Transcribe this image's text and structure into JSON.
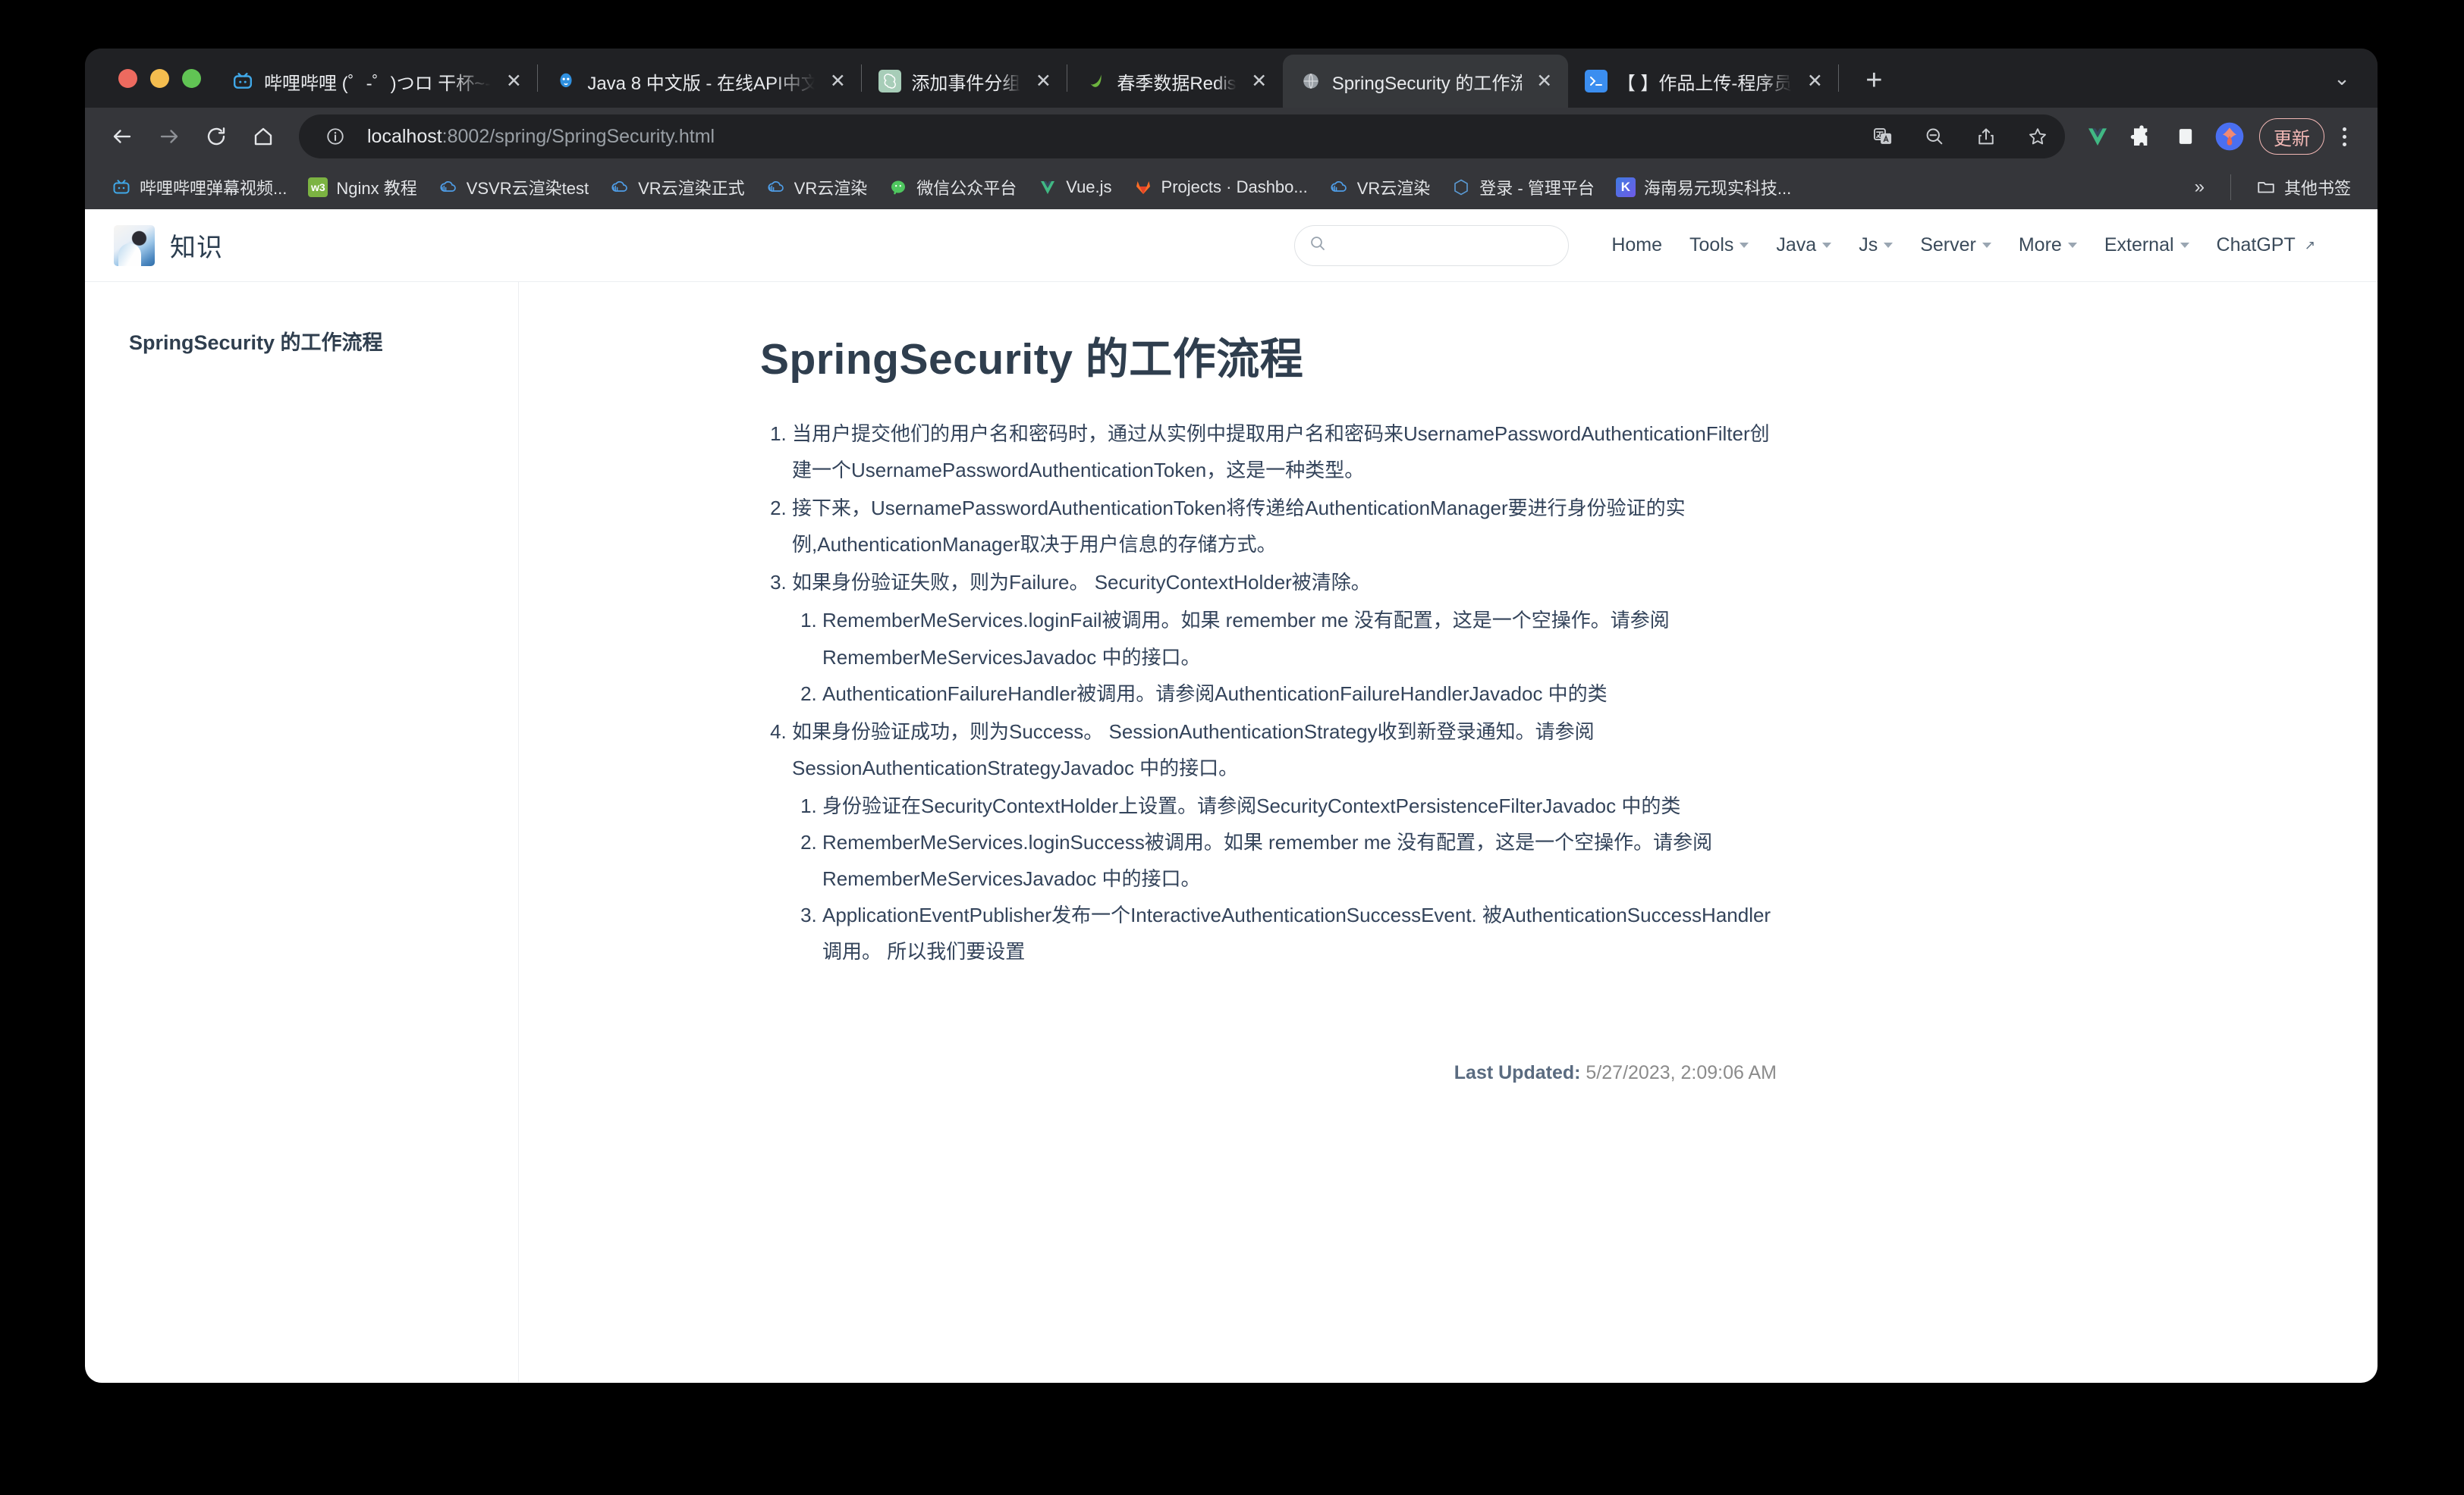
{
  "browser": {
    "tabs": [
      {
        "title": "哔哩哔哩 (゜-゜)つロ 干杯~-",
        "favicon": "bilibili-icon",
        "active": false
      },
      {
        "title": "Java 8 中文版 - 在线API中文",
        "favicon": "java-icon",
        "active": false
      },
      {
        "title": "添加事件分组",
        "favicon": "chatgpt-icon",
        "active": false
      },
      {
        "title": "春季数据Redis",
        "favicon": "spring-icon",
        "active": false
      },
      {
        "title": "SpringSecurity 的工作流程",
        "favicon": "globe-icon",
        "active": true
      },
      {
        "title": "【        】作品上传-程序员",
        "favicon": "terminal-icon",
        "active": false
      }
    ],
    "close_label": "✕",
    "new_tab_label": "+",
    "tabstrip_overflow_label": "⌄",
    "toolbar": {
      "back_label": "back-arrow",
      "forward_label": "forward-arrow",
      "reload_label": "reload",
      "home_label": "home",
      "url_host": "localhost",
      "url_path": ":8002/spring/SpringSecurity.html",
      "site_info_label": "ⓘ",
      "icons": [
        "translate-icon",
        "zoom-out-icon",
        "share-icon",
        "bookmark-star-icon"
      ],
      "extensions": [
        "vue-extension-icon",
        "puzzle-extension-icon",
        "side-panel-icon",
        "profile-avatar-icon"
      ],
      "update_label": "更新"
    },
    "bookmarks": [
      {
        "label": "哔哩哔哩弹幕视频...",
        "icon": "bilibili-icon"
      },
      {
        "label": "Nginx 教程",
        "icon": "w3c-icon"
      },
      {
        "label": "VSVR云渲染test",
        "icon": "cloud-icon"
      },
      {
        "label": "VR云渲染正式",
        "icon": "cloud-icon"
      },
      {
        "label": "VR云渲染",
        "icon": "cloud-icon"
      },
      {
        "label": "微信公众平台",
        "icon": "wechat-icon"
      },
      {
        "label": "Vue.js",
        "icon": "vue-icon"
      },
      {
        "label": "Projects · Dashbo...",
        "icon": "gitlab-icon"
      },
      {
        "label": "VR云渲染",
        "icon": "cloud-icon"
      },
      {
        "label": "登录 - 管理平台",
        "icon": "hexagon-icon"
      },
      {
        "label": "海南易元现实科技...",
        "icon": "k-icon"
      }
    ],
    "bookmarks_overflow_label": "»",
    "other_bookmarks_label": "其他书签",
    "other_bookmarks_icon": "folder-icon"
  },
  "site": {
    "brand_title": "知识",
    "search_placeholder": "",
    "search_value": "",
    "search_icon": "search-icon",
    "nav": [
      {
        "label": "Home",
        "has_caret": false,
        "external": false
      },
      {
        "label": "Tools",
        "has_caret": true,
        "external": false
      },
      {
        "label": "Java",
        "has_caret": true,
        "external": false
      },
      {
        "label": "Js",
        "has_caret": true,
        "external": false
      },
      {
        "label": "Server",
        "has_caret": true,
        "external": false
      },
      {
        "label": "More",
        "has_caret": true,
        "external": false
      },
      {
        "label": "External",
        "has_caret": true,
        "external": false
      },
      {
        "label": "ChatGPT",
        "has_caret": false,
        "external": true
      }
    ],
    "external_link_glyph": "↗"
  },
  "sidebar": {
    "heading": "SpringSecurity 的工作流程"
  },
  "document": {
    "title": "SpringSecurity 的工作流程",
    "steps": [
      {
        "text": "当用户提交他们的用户名和密码时，通过从实例中提取用户名和密码来UsernamePasswordAuthenticationFilter创建一个UsernamePasswordAuthenticationToken，这是一种类型。",
        "children": []
      },
      {
        "text": "接下来，UsernamePasswordAuthenticationToken将传递给AuthenticationManager要进行身份验证的实例,AuthenticationManager取决于用户信息的存储方式。",
        "children": []
      },
      {
        "text": "如果身份验证失败，则为Failure。 SecurityContextHolder被清除。",
        "children": [
          "RememberMeServices.loginFail被调用。如果 remember me 没有配置，这是一个空操作。请参阅RememberMeServicesJavadoc 中的接口。",
          "AuthenticationFailureHandler被调用。请参阅AuthenticationFailureHandlerJavadoc 中的类"
        ]
      },
      {
        "text": "如果身份验证成功，则为Success。 SessionAuthenticationStrategy收到新登录通知。请参阅SessionAuthenticationStrategyJavadoc 中的接口。",
        "children": [
          "身份验证在SecurityContextHolder上设置。请参阅SecurityContextPersistenceFilterJavadoc 中的类",
          "RememberMeServices.loginSuccess被调用。如果 remember me 没有配置，这是一个空操作。请参阅RememberMeServicesJavadoc 中的接口。",
          "ApplicationEventPublisher发布一个InteractiveAuthenticationSuccessEvent. 被AuthenticationSuccessHandler调用。 所以我们要设置"
        ]
      }
    ],
    "last_updated_label": "Last Updated:",
    "last_updated_value": "5/27/2023, 2:09:06 AM"
  }
}
